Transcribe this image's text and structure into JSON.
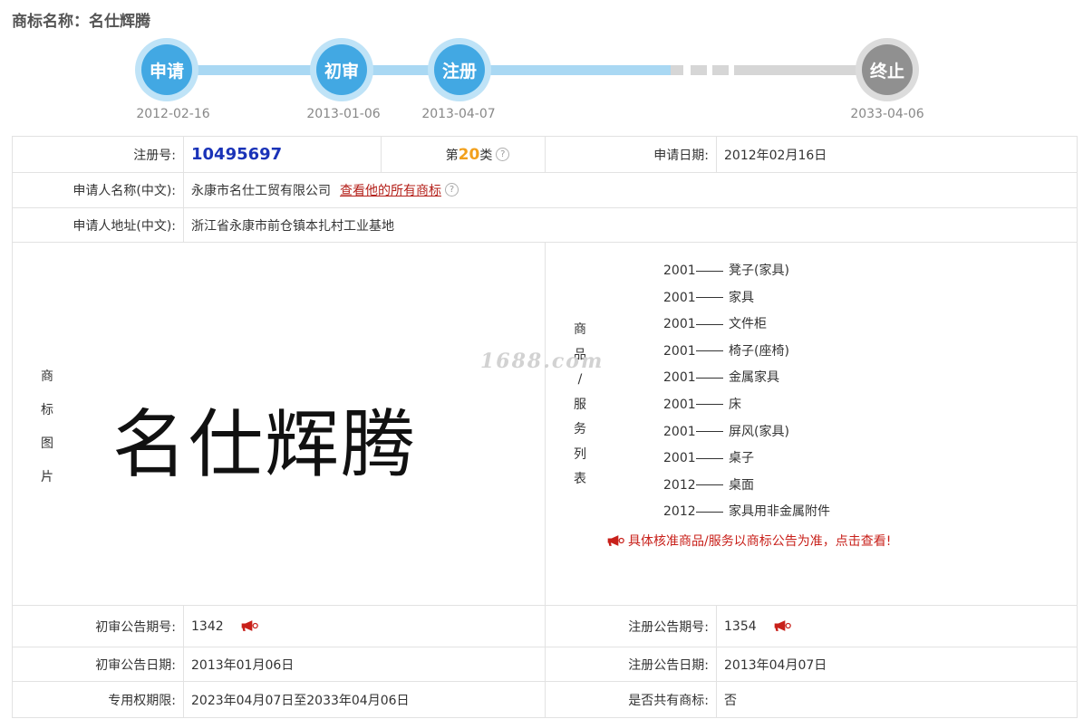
{
  "header": {
    "title": "商标名称：名仕辉腾"
  },
  "timeline": {
    "steps": [
      {
        "label": "申请",
        "date": "2012-02-16",
        "state": "done"
      },
      {
        "label": "初审",
        "date": "2013-01-06",
        "state": "done"
      },
      {
        "label": "注册",
        "date": "2013-04-07",
        "state": "done"
      },
      {
        "label": "终止",
        "date": "2033-04-06",
        "state": "future"
      }
    ]
  },
  "info": {
    "reg_no_label": "注册号:",
    "reg_no": "10495697",
    "class_prefix": "第",
    "class_num": "20",
    "class_suffix": "类",
    "apply_date_label": "申请日期:",
    "apply_date": "2012年02月16日",
    "applicant_label": "申请人名称(中文):",
    "applicant": "永康市名仕工贸有限公司",
    "view_all_link": "查看他的所有商标",
    "address_label": "申请人地址(中文):",
    "address": "浙江省永康市前仓镇本扎村工业基地",
    "image_label": "商标图片",
    "mark_text": "名仕辉腾",
    "goods_label": "商品/服务列表",
    "goods": [
      {
        "code": "2001",
        "name": "凳子(家具)"
      },
      {
        "code": "2001",
        "name": "家具"
      },
      {
        "code": "2001",
        "name": "文件柜"
      },
      {
        "code": "2001",
        "name": "椅子(座椅)"
      },
      {
        "code": "2001",
        "name": "金属家具"
      },
      {
        "code": "2001",
        "name": "床"
      },
      {
        "code": "2001",
        "name": "屏风(家具)"
      },
      {
        "code": "2001",
        "name": "桌子"
      },
      {
        "code": "2012",
        "name": "桌面"
      },
      {
        "code": "2012",
        "name": "家具用非金属附件"
      }
    ],
    "goods_notice": "具体核准商品/服务以商标公告为准，点击查看!",
    "prelim_no_label": "初审公告期号:",
    "prelim_no": "1342",
    "reg_pub_no_label": "注册公告期号:",
    "reg_pub_no": "1354",
    "prelim_date_label": "初审公告日期:",
    "prelim_date": "2013年01月06日",
    "reg_pub_date_label": "注册公告日期:",
    "reg_pub_date": "2013年04月07日",
    "term_label": "专用权期限:",
    "term": "2023年04月07日至2033年04月06日",
    "shared_label": "是否共有商标:",
    "shared": "否"
  },
  "watermark": "1688.com",
  "colors": {
    "accent_blue": "#42a8e3",
    "reg_no_blue": "#1a33b8",
    "class_orange": "#f2a01c",
    "notice_red": "#c8201a"
  }
}
